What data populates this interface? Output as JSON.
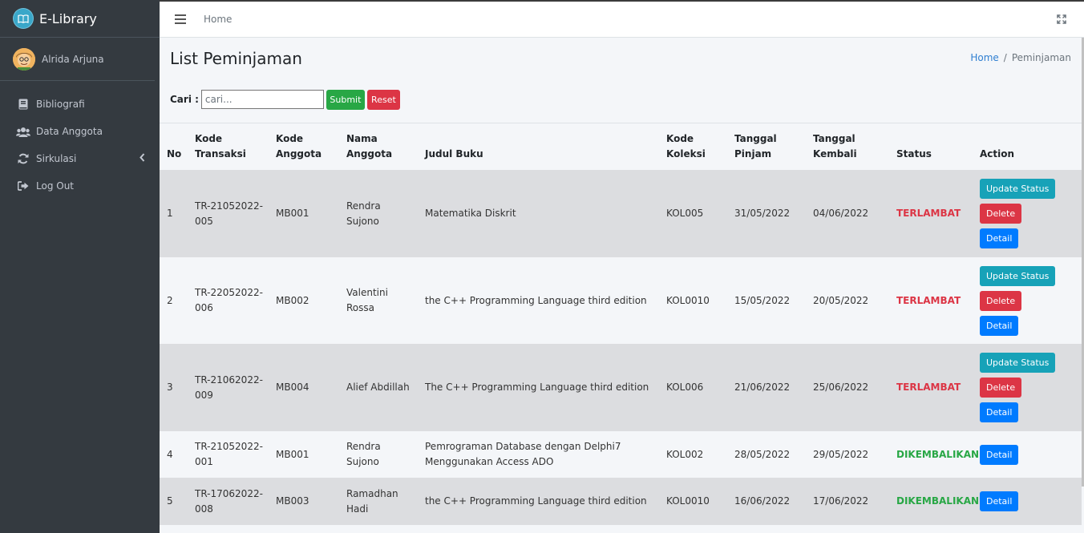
{
  "brand": {
    "name": "E-Library"
  },
  "user": {
    "name": "Alrida Arjuna"
  },
  "nav": [
    {
      "label": "Bibliografi",
      "icon": "book-icon"
    },
    {
      "label": "Data Anggota",
      "icon": "users-icon"
    },
    {
      "label": "Sirkulasi",
      "icon": "sync-icon"
    },
    {
      "label": "Log Out",
      "icon": "logout-icon"
    }
  ],
  "topbar": {
    "home": "Home"
  },
  "header": {
    "title": "List Peminjaman"
  },
  "breadcrumb": {
    "home": "Home",
    "sep": "/",
    "current": "Peminjaman"
  },
  "search": {
    "label": "Cari :",
    "placeholder": "cari...",
    "value": "",
    "submit": "Submit",
    "reset": "Reset"
  },
  "table": {
    "headers": {
      "no": "No",
      "kode_transaksi": [
        "Kode",
        "Transaksi"
      ],
      "kode_anggota": [
        "Kode",
        "Anggota"
      ],
      "nama_anggota": [
        "Nama",
        "Anggota"
      ],
      "judul_buku": "Judul Buku",
      "kode_koleksi": [
        "Kode",
        "Koleksi"
      ],
      "tanggal_pinjam": [
        "Tanggal",
        "Pinjam"
      ],
      "tanggal_kembali": [
        "Tanggal",
        "Kembali"
      ],
      "status": "Status",
      "action": "Action"
    },
    "actions": {
      "update": "Update Status",
      "delete": "Delete",
      "detail": "Detail"
    },
    "rows": [
      {
        "no": "1",
        "kode_transaksi": [
          "TR-21052022-",
          "005"
        ],
        "kode_anggota": "MB001",
        "nama_anggota": [
          "Rendra",
          "Sujono"
        ],
        "judul_buku": [
          "Matematika Diskrit"
        ],
        "kode_koleksi": "KOL005",
        "tanggal_pinjam": "31/05/2022",
        "tanggal_kembali": "04/06/2022",
        "status": "TERLAMBAT",
        "status_type": "late"
      },
      {
        "no": "2",
        "kode_transaksi": [
          "TR-22052022-",
          "006"
        ],
        "kode_anggota": "MB002",
        "nama_anggota": [
          "Valentini",
          "Rossa"
        ],
        "judul_buku": [
          "the C++ Programming Language third edition"
        ],
        "kode_koleksi": "KOL0010",
        "tanggal_pinjam": "15/05/2022",
        "tanggal_kembali": "20/05/2022",
        "status": "TERLAMBAT",
        "status_type": "late"
      },
      {
        "no": "3",
        "kode_transaksi": [
          "TR-21062022-",
          "009"
        ],
        "kode_anggota": "MB004",
        "nama_anggota": [
          "Alief Abdillah"
        ],
        "judul_buku": [
          "The C++ Programming Language third edition"
        ],
        "kode_koleksi": "KOL006",
        "tanggal_pinjam": "21/06/2022",
        "tanggal_kembali": "25/06/2022",
        "status": "TERLAMBAT",
        "status_type": "late"
      },
      {
        "no": "4",
        "kode_transaksi": [
          "TR-21052022-",
          "001"
        ],
        "kode_anggota": "MB001",
        "nama_anggota": [
          "Rendra",
          "Sujono"
        ],
        "judul_buku": [
          "Pemrograman Database dengan Delphi7",
          "Menggunakan Access ADO"
        ],
        "kode_koleksi": "KOL002",
        "tanggal_pinjam": "28/05/2022",
        "tanggal_kembali": "29/05/2022",
        "status": "DIKEMBALIKAN",
        "status_type": "done"
      },
      {
        "no": "5",
        "kode_transaksi": [
          "TR-17062022-",
          "008"
        ],
        "kode_anggota": "MB003",
        "nama_anggota": [
          "Ramadhan",
          "Hadi"
        ],
        "judul_buku": [
          "the C++ Programming Language third edition"
        ],
        "kode_koleksi": "KOL0010",
        "tanggal_pinjam": "16/06/2022",
        "tanggal_kembali": "17/06/2022",
        "status": "DIKEMBALIKAN",
        "status_type": "done"
      }
    ]
  }
}
